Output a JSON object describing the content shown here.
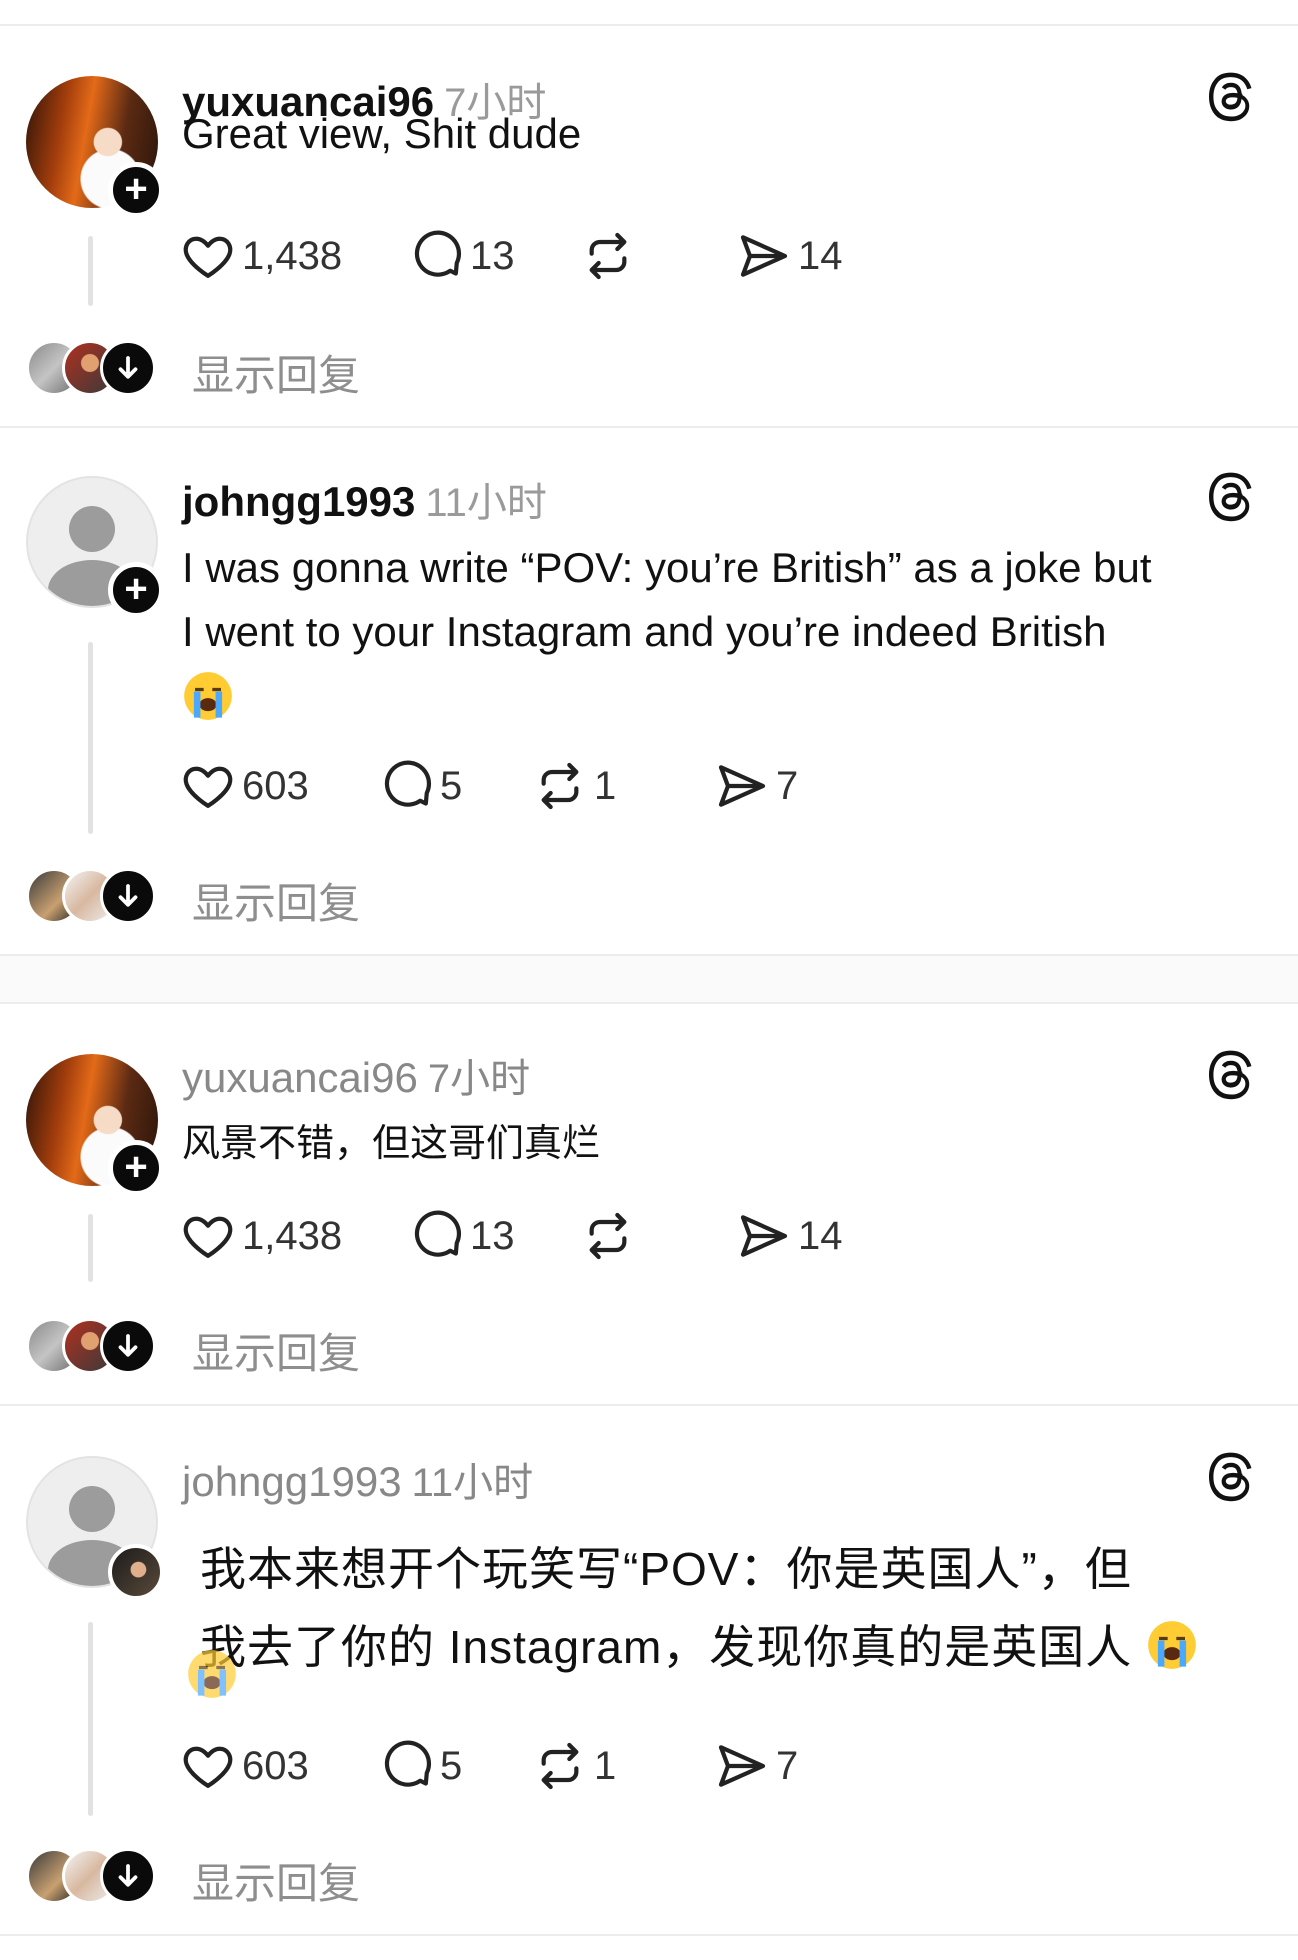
{
  "posts": [
    {
      "username": "yuxuancai96",
      "time": "7小时",
      "text_lines": [
        "Great view, Shit dude"
      ],
      "likes": "1,438",
      "comments": "13",
      "reposts": "",
      "shares": "14",
      "show_replies": "显示回复"
    },
    {
      "username": "johngg1993",
      "time": "11小时",
      "text_lines": [
        "I was gonna write “POV: you’re British” as a joke but",
        "I went to your Instagram and you’re indeed British"
      ],
      "emoji": "loudly-crying-face",
      "likes": "603",
      "comments": "5",
      "reposts": "1",
      "shares": "7",
      "show_replies": "显示回复"
    },
    {
      "username": "yuxuancai96",
      "time": "7小时",
      "text_lines": [
        "风景不错，但这哥们真烂"
      ],
      "likes": "1,438",
      "comments": "13",
      "reposts": "",
      "shares": "14",
      "show_replies": "显示回复"
    },
    {
      "username": "johngg1993",
      "time": "11小时",
      "text_lines": [
        "我本来想开个玩笑写“POV：你是英国人”，但",
        "我去了你的 Instagram，发现你真的是英国人"
      ],
      "emoji": "loudly-crying-face",
      "likes": "603",
      "comments": "5",
      "reposts": "1",
      "shares": "7",
      "show_replies": "显示回复"
    }
  ],
  "icons": {
    "like": "heart-icon",
    "comment": "comment-bubble-icon",
    "repost": "repost-icon",
    "share": "send-icon",
    "brand": "threads-logo-icon"
  },
  "colors": {
    "text": "#101010",
    "secondary": "#9a9a9a",
    "badge": "#0a0a0a"
  }
}
